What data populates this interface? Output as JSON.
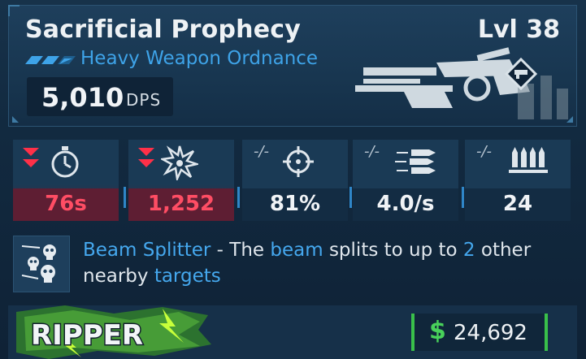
{
  "weapon": {
    "name": "Sacrificial Prophecy",
    "level": "Lvl 38",
    "type": "Heavy Weapon Ordnance",
    "dps_value": "5,010",
    "dps_unit": "DPS",
    "rarity_icon": "rarity-chevrons-icon",
    "art_icon": "heavy-weapon-silhouette-icon"
  },
  "stats": [
    {
      "icon": "stopwatch-icon",
      "value": "76s",
      "compare": "",
      "trend": "down"
    },
    {
      "icon": "impact-burst-icon",
      "value": "1,252",
      "compare": "",
      "trend": "down"
    },
    {
      "icon": "crosshair-icon",
      "value": "81%",
      "compare": "-/-",
      "trend": "none"
    },
    {
      "icon": "bullets-icon",
      "value": "4.0/s",
      "compare": "-/-",
      "trend": "none"
    },
    {
      "icon": "ammo-stack-icon",
      "value": "24",
      "compare": "-/-",
      "trend": "none"
    }
  ],
  "perk": {
    "icon": "skulls-icon",
    "name": "Beam Splitter",
    "dash": " - The ",
    "word1": "beam",
    "mid": " splits to up to ",
    "count": "2",
    "after": " other nearby ",
    "word2": "targets"
  },
  "footer": {
    "maker_logo": "ripper-logo",
    "maker_text": "RIPPER",
    "price_symbol": "$",
    "price": "24,692"
  },
  "colors": {
    "accent_blue": "#3ea3e8",
    "negative_red": "#ff4d64",
    "money_green": "#48d15a",
    "panel": "#1a3a55"
  }
}
